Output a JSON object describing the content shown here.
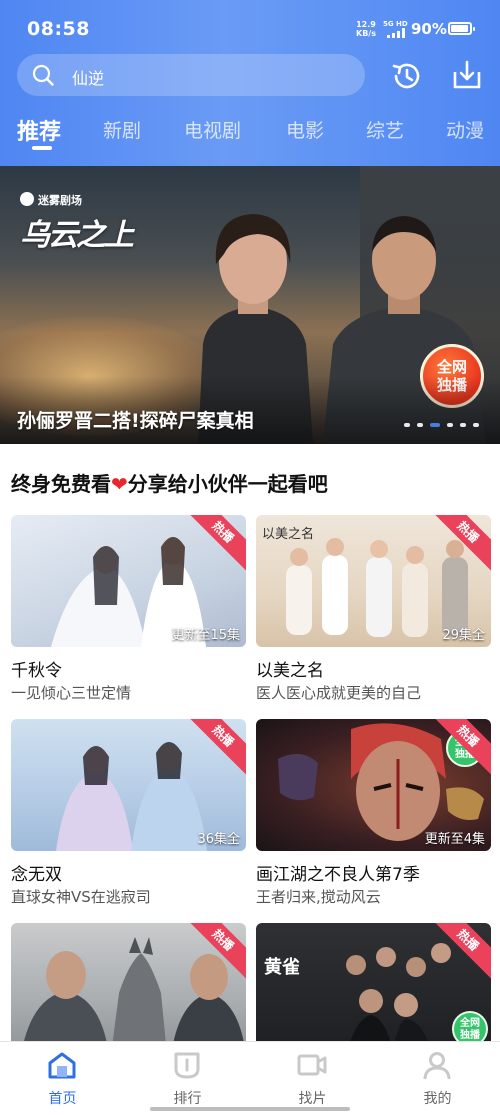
{
  "status_bar": {
    "time": "08:58",
    "net_speed_value": "12.9",
    "net_speed_unit": "KB/s",
    "wifi_label": "5G HD",
    "battery": "90%"
  },
  "search": {
    "query": "仙逆"
  },
  "tabs": [
    {
      "label": "推荐",
      "active": true
    },
    {
      "label": "新剧",
      "active": false
    },
    {
      "label": "电视剧",
      "active": false
    },
    {
      "label": "电影",
      "active": false
    },
    {
      "label": "综艺",
      "active": false
    },
    {
      "label": "动漫",
      "active": false
    }
  ],
  "banner": {
    "brand": "迷雾剧场",
    "show_logo": "乌云之上",
    "badge_line1": "全网",
    "badge_line2": "独播",
    "caption": "孙俪罗晋二搭!探碎尸案真相",
    "carousel_count": 6,
    "carousel_active": 2
  },
  "section": {
    "title_part1": "终身免费看",
    "heart": "❤",
    "title_part2": "分享给小伙伴一起看吧"
  },
  "cards": [
    {
      "hot": "热播",
      "episode": "更新至15集",
      "title": "千秋令",
      "desc": "一见倾心三世定情"
    },
    {
      "hot": "热播",
      "episode": "29集全",
      "title": "以美之名",
      "desc": "医人医心成就更美的自己"
    },
    {
      "hot": "热播",
      "episode": "36集全",
      "title": "念无双",
      "desc": "直球女神VS在逃寂司"
    },
    {
      "hot": "热播",
      "episode": "更新至4集",
      "title": "画江湖之不良人第7季",
      "desc": "王者归来,搅动风云"
    },
    {
      "hot": "热播"
    },
    {
      "hot": "热播"
    }
  ],
  "thumb_text": {
    "card2_overlay": "以美之名",
    "card6_overlay": "黄雀",
    "card4_badge_line1": "全网",
    "card4_badge_line2": "独播",
    "card6_badge_line1": "全网",
    "card6_badge_line2": "独播"
  },
  "bottom_nav": [
    {
      "label": "首页",
      "icon": "home-icon",
      "active": true
    },
    {
      "label": "排行",
      "icon": "ranking-icon",
      "active": false
    },
    {
      "label": "找片",
      "icon": "video-search-icon",
      "active": false
    },
    {
      "label": "我的",
      "icon": "profile-icon",
      "active": false
    }
  ],
  "colors": {
    "accent": "#2f6fe6",
    "header": "#5c91f4",
    "hot_tag": "#e9425a",
    "heart": "#e8262d"
  }
}
